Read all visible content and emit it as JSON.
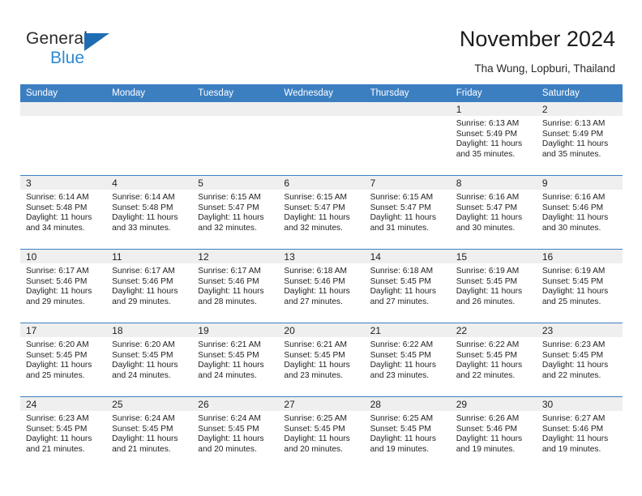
{
  "brand": {
    "word_one": "General",
    "word_two": "Blue",
    "triangle_icon": "triangle-icon",
    "accent_dark_blue": "#1f6cb4",
    "accent_light_blue": "#2e8ad4"
  },
  "header": {
    "title": "November 2024",
    "location": "Tha Wung, Lopburi, Thailand",
    "header_bg": "#3c7fc1",
    "daynum_bg": "#efefef"
  },
  "weekday_headers": [
    "Sunday",
    "Monday",
    "Tuesday",
    "Wednesday",
    "Thursday",
    "Friday",
    "Saturday"
  ],
  "labels": {
    "sunrise": "Sunrise:",
    "sunset": "Sunset:",
    "daylight": "Daylight:"
  },
  "weeks": [
    [
      {
        "day": "",
        "empty": true
      },
      {
        "day": "",
        "empty": true
      },
      {
        "day": "",
        "empty": true
      },
      {
        "day": "",
        "empty": true
      },
      {
        "day": "",
        "empty": true
      },
      {
        "day": "1",
        "sunrise": "Sunrise: 6:13 AM",
        "sunset": "Sunset: 5:49 PM",
        "daylight_line1": "Daylight: 11 hours",
        "daylight_line2": "and 35 minutes."
      },
      {
        "day": "2",
        "sunrise": "Sunrise: 6:13 AM",
        "sunset": "Sunset: 5:49 PM",
        "daylight_line1": "Daylight: 11 hours",
        "daylight_line2": "and 35 minutes."
      }
    ],
    [
      {
        "day": "3",
        "sunrise": "Sunrise: 6:14 AM",
        "sunset": "Sunset: 5:48 PM",
        "daylight_line1": "Daylight: 11 hours",
        "daylight_line2": "and 34 minutes."
      },
      {
        "day": "4",
        "sunrise": "Sunrise: 6:14 AM",
        "sunset": "Sunset: 5:48 PM",
        "daylight_line1": "Daylight: 11 hours",
        "daylight_line2": "and 33 minutes."
      },
      {
        "day": "5",
        "sunrise": "Sunrise: 6:15 AM",
        "sunset": "Sunset: 5:47 PM",
        "daylight_line1": "Daylight: 11 hours",
        "daylight_line2": "and 32 minutes."
      },
      {
        "day": "6",
        "sunrise": "Sunrise: 6:15 AM",
        "sunset": "Sunset: 5:47 PM",
        "daylight_line1": "Daylight: 11 hours",
        "daylight_line2": "and 32 minutes."
      },
      {
        "day": "7",
        "sunrise": "Sunrise: 6:15 AM",
        "sunset": "Sunset: 5:47 PM",
        "daylight_line1": "Daylight: 11 hours",
        "daylight_line2": "and 31 minutes."
      },
      {
        "day": "8",
        "sunrise": "Sunrise: 6:16 AM",
        "sunset": "Sunset: 5:47 PM",
        "daylight_line1": "Daylight: 11 hours",
        "daylight_line2": "and 30 minutes."
      },
      {
        "day": "9",
        "sunrise": "Sunrise: 6:16 AM",
        "sunset": "Sunset: 5:46 PM",
        "daylight_line1": "Daylight: 11 hours",
        "daylight_line2": "and 30 minutes."
      }
    ],
    [
      {
        "day": "10",
        "sunrise": "Sunrise: 6:17 AM",
        "sunset": "Sunset: 5:46 PM",
        "daylight_line1": "Daylight: 11 hours",
        "daylight_line2": "and 29 minutes."
      },
      {
        "day": "11",
        "sunrise": "Sunrise: 6:17 AM",
        "sunset": "Sunset: 5:46 PM",
        "daylight_line1": "Daylight: 11 hours",
        "daylight_line2": "and 29 minutes."
      },
      {
        "day": "12",
        "sunrise": "Sunrise: 6:17 AM",
        "sunset": "Sunset: 5:46 PM",
        "daylight_line1": "Daylight: 11 hours",
        "daylight_line2": "and 28 minutes."
      },
      {
        "day": "13",
        "sunrise": "Sunrise: 6:18 AM",
        "sunset": "Sunset: 5:46 PM",
        "daylight_line1": "Daylight: 11 hours",
        "daylight_line2": "and 27 minutes."
      },
      {
        "day": "14",
        "sunrise": "Sunrise: 6:18 AM",
        "sunset": "Sunset: 5:45 PM",
        "daylight_line1": "Daylight: 11 hours",
        "daylight_line2": "and 27 minutes."
      },
      {
        "day": "15",
        "sunrise": "Sunrise: 6:19 AM",
        "sunset": "Sunset: 5:45 PM",
        "daylight_line1": "Daylight: 11 hours",
        "daylight_line2": "and 26 minutes."
      },
      {
        "day": "16",
        "sunrise": "Sunrise: 6:19 AM",
        "sunset": "Sunset: 5:45 PM",
        "daylight_line1": "Daylight: 11 hours",
        "daylight_line2": "and 25 minutes."
      }
    ],
    [
      {
        "day": "17",
        "sunrise": "Sunrise: 6:20 AM",
        "sunset": "Sunset: 5:45 PM",
        "daylight_line1": "Daylight: 11 hours",
        "daylight_line2": "and 25 minutes."
      },
      {
        "day": "18",
        "sunrise": "Sunrise: 6:20 AM",
        "sunset": "Sunset: 5:45 PM",
        "daylight_line1": "Daylight: 11 hours",
        "daylight_line2": "and 24 minutes."
      },
      {
        "day": "19",
        "sunrise": "Sunrise: 6:21 AM",
        "sunset": "Sunset: 5:45 PM",
        "daylight_line1": "Daylight: 11 hours",
        "daylight_line2": "and 24 minutes."
      },
      {
        "day": "20",
        "sunrise": "Sunrise: 6:21 AM",
        "sunset": "Sunset: 5:45 PM",
        "daylight_line1": "Daylight: 11 hours",
        "daylight_line2": "and 23 minutes."
      },
      {
        "day": "21",
        "sunrise": "Sunrise: 6:22 AM",
        "sunset": "Sunset: 5:45 PM",
        "daylight_line1": "Daylight: 11 hours",
        "daylight_line2": "and 23 minutes."
      },
      {
        "day": "22",
        "sunrise": "Sunrise: 6:22 AM",
        "sunset": "Sunset: 5:45 PM",
        "daylight_line1": "Daylight: 11 hours",
        "daylight_line2": "and 22 minutes."
      },
      {
        "day": "23",
        "sunrise": "Sunrise: 6:23 AM",
        "sunset": "Sunset: 5:45 PM",
        "daylight_line1": "Daylight: 11 hours",
        "daylight_line2": "and 22 minutes."
      }
    ],
    [
      {
        "day": "24",
        "sunrise": "Sunrise: 6:23 AM",
        "sunset": "Sunset: 5:45 PM",
        "daylight_line1": "Daylight: 11 hours",
        "daylight_line2": "and 21 minutes."
      },
      {
        "day": "25",
        "sunrise": "Sunrise: 6:24 AM",
        "sunset": "Sunset: 5:45 PM",
        "daylight_line1": "Daylight: 11 hours",
        "daylight_line2": "and 21 minutes."
      },
      {
        "day": "26",
        "sunrise": "Sunrise: 6:24 AM",
        "sunset": "Sunset: 5:45 PM",
        "daylight_line1": "Daylight: 11 hours",
        "daylight_line2": "and 20 minutes."
      },
      {
        "day": "27",
        "sunrise": "Sunrise: 6:25 AM",
        "sunset": "Sunset: 5:45 PM",
        "daylight_line1": "Daylight: 11 hours",
        "daylight_line2": "and 20 minutes."
      },
      {
        "day": "28",
        "sunrise": "Sunrise: 6:25 AM",
        "sunset": "Sunset: 5:45 PM",
        "daylight_line1": "Daylight: 11 hours",
        "daylight_line2": "and 19 minutes."
      },
      {
        "day": "29",
        "sunrise": "Sunrise: 6:26 AM",
        "sunset": "Sunset: 5:46 PM",
        "daylight_line1": "Daylight: 11 hours",
        "daylight_line2": "and 19 minutes."
      },
      {
        "day": "30",
        "sunrise": "Sunrise: 6:27 AM",
        "sunset": "Sunset: 5:46 PM",
        "daylight_line1": "Daylight: 11 hours",
        "daylight_line2": "and 19 minutes."
      }
    ]
  ]
}
